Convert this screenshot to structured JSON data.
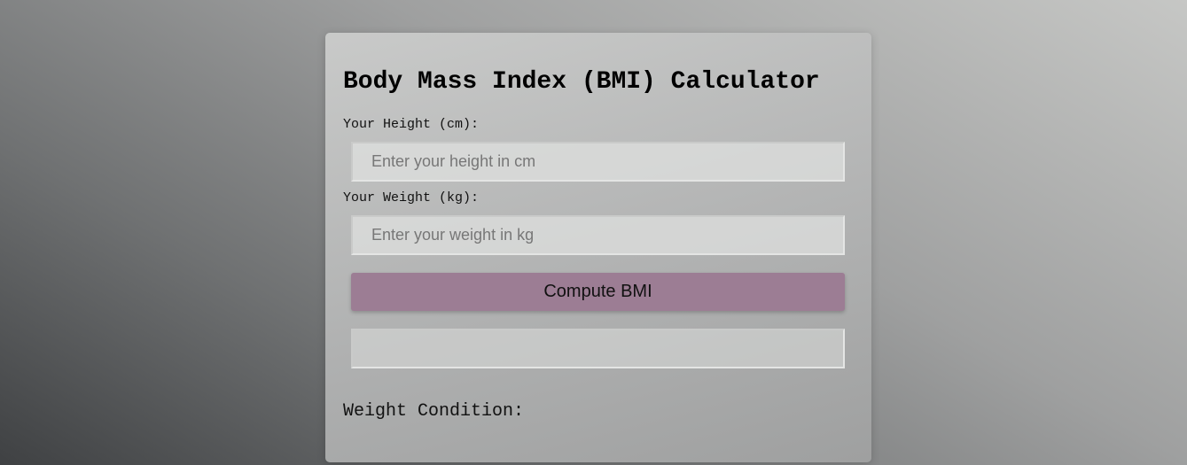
{
  "title": "Body Mass Index (BMI) Calculator",
  "height": {
    "label": "Your Height (cm):",
    "placeholder": "Enter your height in cm",
    "value": ""
  },
  "weight": {
    "label": "Your Weight (kg):",
    "placeholder": "Enter your weight in kg",
    "value": ""
  },
  "compute_button": {
    "label": "Compute BMI",
    "color": "#9c7d94"
  },
  "result": {
    "value": ""
  },
  "condition": {
    "label": "Weight Condition:"
  }
}
